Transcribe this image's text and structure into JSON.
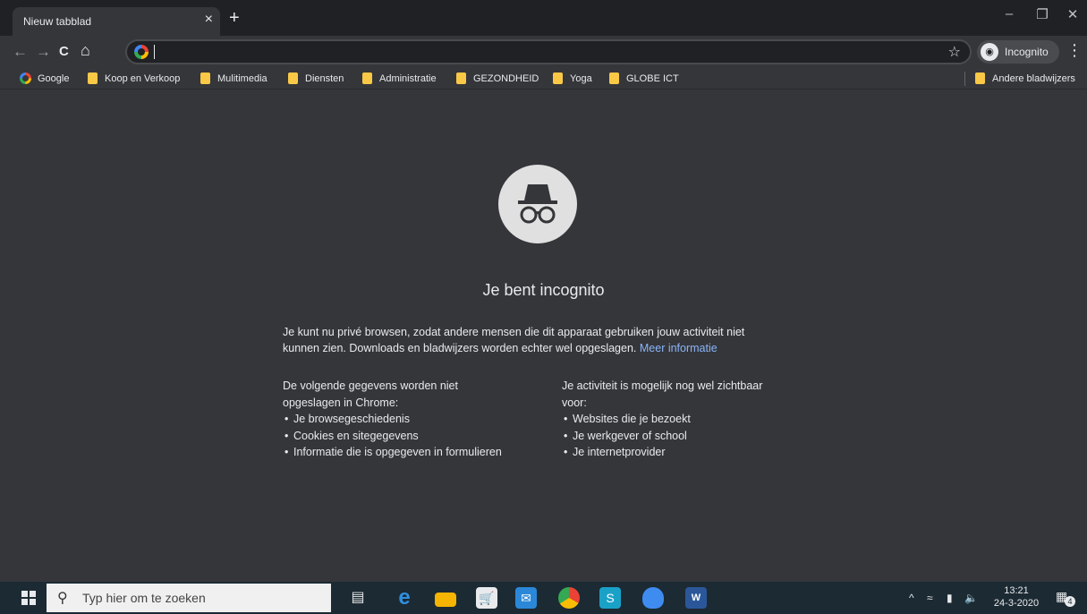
{
  "tabs": [
    {
      "title": "Nieuw tabblad",
      "close": "×"
    }
  ],
  "new_tab": "+",
  "window_controls": {
    "minimize": "–",
    "restore": "❐",
    "close": "✕"
  },
  "toolbar": {
    "back": "←",
    "forward": "→",
    "reload": "C",
    "home": "⌂",
    "omnibox_value": "",
    "star": "☆",
    "incognito_label": "Incognito",
    "menu": "⋮"
  },
  "bookmarks": [
    {
      "label": "Google",
      "icon": "google-icon"
    },
    {
      "label": "Koop en Verkoop",
      "icon": "folder-icon"
    },
    {
      "label": "Mulitimedia",
      "icon": "folder-icon"
    },
    {
      "label": "Diensten",
      "icon": "folder-icon"
    },
    {
      "label": "Administratie",
      "icon": "folder-icon"
    },
    {
      "label": "GEZONDHEID",
      "icon": "folder-icon"
    },
    {
      "label": "Yoga",
      "icon": "folder-icon"
    },
    {
      "label": "GLOBE ICT",
      "icon": "folder-icon"
    }
  ],
  "other_bookmarks": "Andere bladwijzers",
  "page": {
    "heading": "Je bent incognito",
    "intro_line1": "Je kunt nu privé browsen, zodat andere mensen die dit apparaat gebruiken jouw activiteit niet",
    "intro_line2": "kunnen zien. Downloads en bladwijzers worden echter wel opgeslagen.",
    "intro_link": "Meer informatie",
    "left_col": {
      "title_line1": "De volgende gegevens worden niet",
      "title_line2": "opgeslagen in Chrome:",
      "items": [
        "Je browsegeschiedenis",
        "Cookies en sitegegevens",
        "Informatie die is opgegeven in formulieren"
      ]
    },
    "right_col": {
      "title_line1": "Je activiteit is mogelijk nog wel zichtbaar",
      "title_line2": "voor:",
      "items": [
        "Websites die je bezoekt",
        "Je werkgever of school",
        "Je internetprovider"
      ]
    }
  },
  "taskbar": {
    "search_placeholder": "Typ hier om te zoeken",
    "time": "13:21",
    "date": "24-3-2020",
    "tray_chevron": "^",
    "notification_count": "4"
  },
  "colors": {
    "background": "#35363a",
    "link": "#8ab4f8",
    "folder": "#f9c846"
  }
}
